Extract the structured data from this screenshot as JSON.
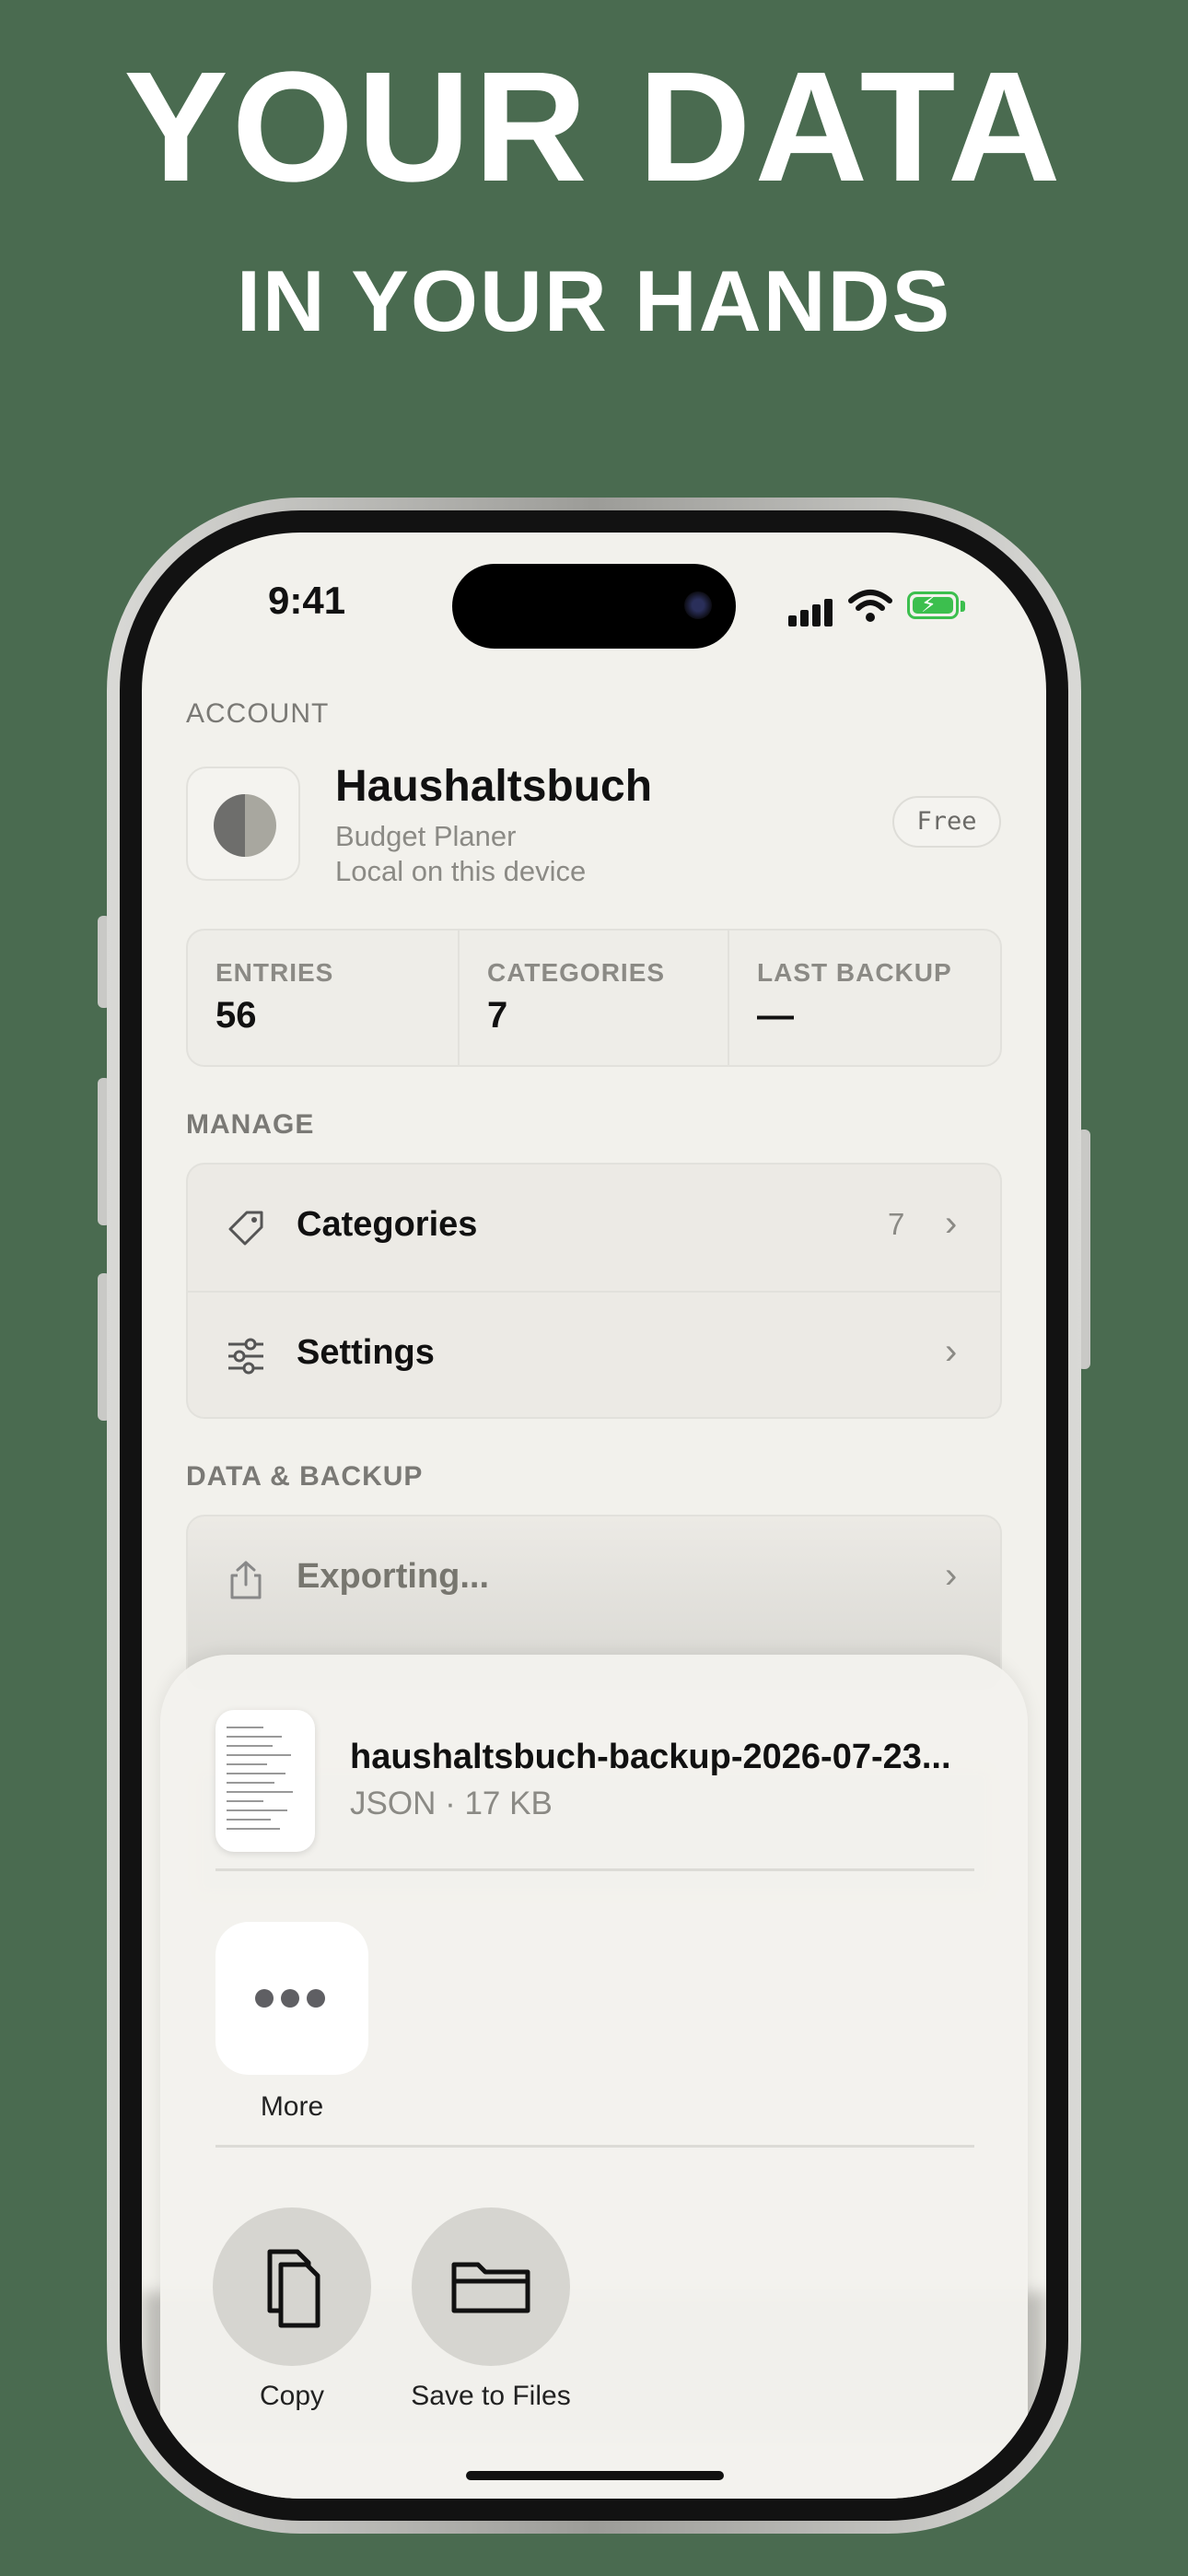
{
  "promo": {
    "headline": "YOUR DATA",
    "subheadline": "IN YOUR HANDS",
    "background_color": "#4a6b50"
  },
  "status_bar": {
    "time": "9:41"
  },
  "account": {
    "section_label": "ACCOUNT",
    "app_name": "Haushaltsbuch",
    "subtitle": "Budget Planer",
    "storage_note": "Local on this device",
    "plan_badge": "Free"
  },
  "stats": [
    {
      "label": "ENTRIES",
      "value": "56"
    },
    {
      "label": "CATEGORIES",
      "value": "7"
    },
    {
      "label": "LAST BACKUP",
      "value": "—"
    }
  ],
  "manage": {
    "section_label": "MANAGE",
    "items": [
      {
        "label": "Categories",
        "count": "7",
        "icon": "tag-icon"
      },
      {
        "label": "Settings",
        "count": "",
        "icon": "sliders-icon"
      }
    ]
  },
  "data_backup": {
    "section_label": "DATA & BACKUP",
    "export_label": "Exporting..."
  },
  "share_sheet": {
    "file_name": "haushaltsbuch-backup-2026-07-23...",
    "file_meta": "JSON · 17 KB",
    "apps": [
      {
        "label": "More",
        "icon": "ellipsis-icon"
      }
    ],
    "actions": [
      {
        "label": "Copy",
        "icon": "copy-icon"
      },
      {
        "label": "Save to Files",
        "icon": "folder-icon"
      }
    ]
  }
}
